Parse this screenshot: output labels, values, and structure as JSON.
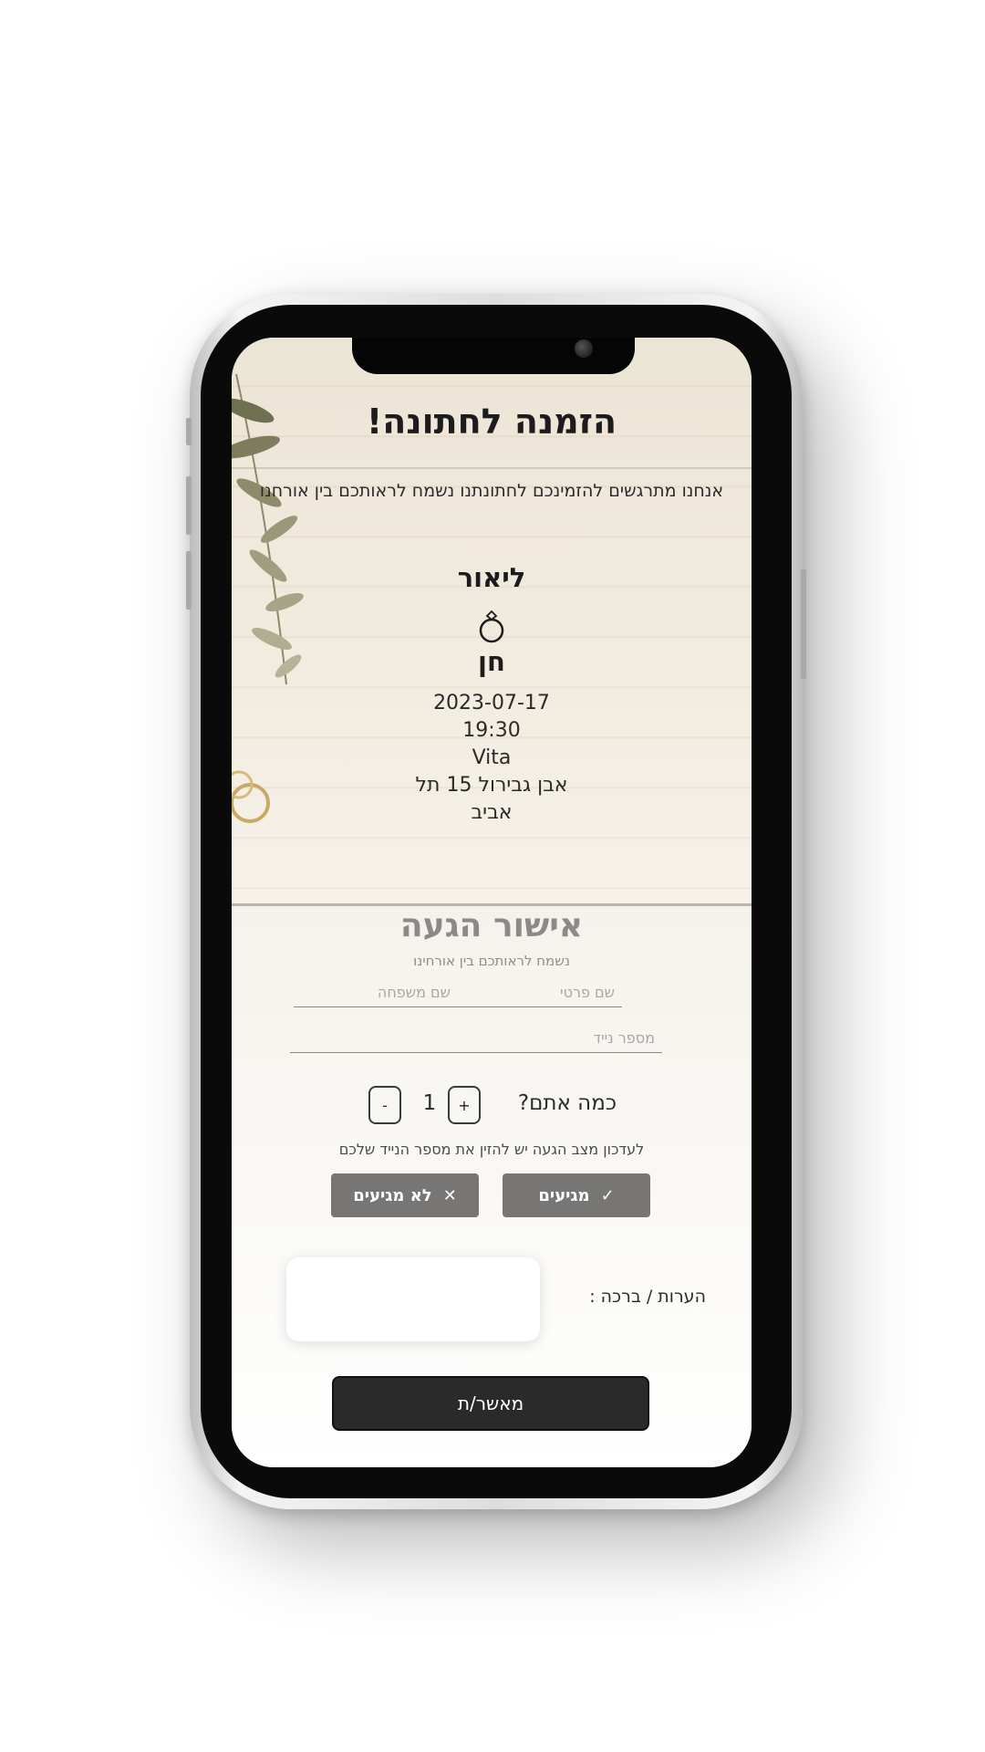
{
  "invitation": {
    "title": "הזמנה לחתונה!",
    "intro": "אנחנו מתרגשים להזמינכם לחתונתנו נשמח לראותכם בין אורחנו",
    "partner_one": "ליאור",
    "partner_two": "חן",
    "ring_icon": "ring-icon",
    "date": "2023-07-17",
    "time": "19:30",
    "venue": "Vita",
    "address_line1": "אבן גבירול 15 תל",
    "address_line2": "אביב"
  },
  "rsvp": {
    "title": "אישור הגעה",
    "subtitle": "נשמח לראותכם בין אורחינו",
    "first_name_placeholder": "שם פרטי",
    "last_name_placeholder": "שם משפחה",
    "phone_placeholder": "מספר נייד",
    "count_label": "כמה אתם?",
    "count_value": "1",
    "plus_label": "+",
    "minus_label": "-",
    "update_note": "לעדכון מצב הגעה יש להזין את מספר הנייד שלכם",
    "attending_label": "מגיעים",
    "attending_icon": "check-icon",
    "not_attending_label": "לא מגיעים",
    "not_attending_icon": "close-icon",
    "notes_label": "הערות / ברכה :",
    "submit_label": "מאשר/ת"
  },
  "colors": {
    "button_gray": "#777675",
    "submit_dark": "#2a2a2a",
    "rsvp_title": "#8c8a87"
  }
}
